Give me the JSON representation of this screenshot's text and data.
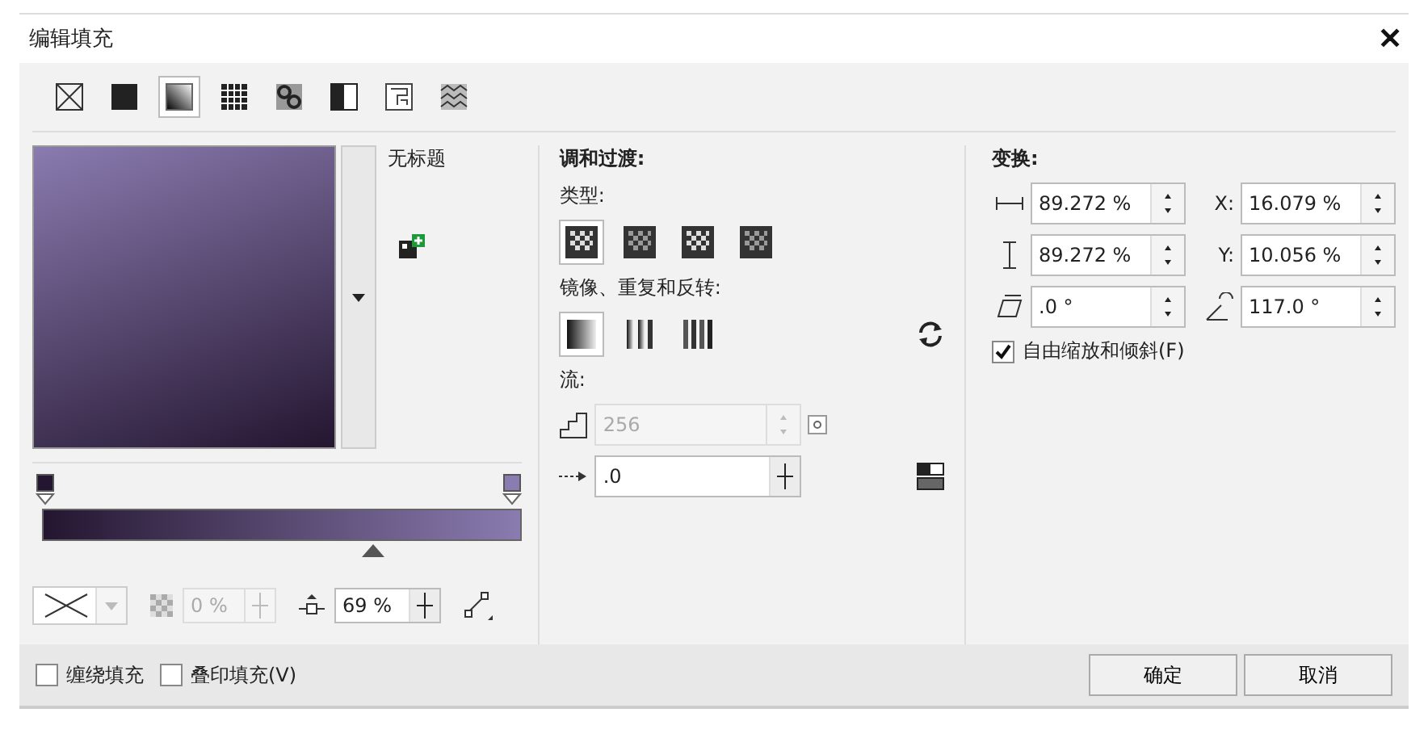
{
  "window": {
    "title": "编辑填充",
    "close": "✕"
  },
  "fill_types": [
    {
      "kind": "none",
      "selected": false
    },
    {
      "kind": "uniform",
      "selected": false
    },
    {
      "kind": "fountain",
      "selected": true
    },
    {
      "kind": "vector",
      "selected": false
    },
    {
      "kind": "bitmap",
      "selected": false
    },
    {
      "kind": "twocolor",
      "selected": false
    },
    {
      "kind": "texture",
      "selected": false
    },
    {
      "kind": "postscript",
      "selected": false
    }
  ],
  "preview": {
    "name": "无标题"
  },
  "nodes": [
    {
      "color": "#241630"
    },
    {
      "color": "#8a7bb0"
    }
  ],
  "midpoint": {
    "level": 0.69,
    "value": "69 %"
  },
  "transparency": {
    "value": "0 %",
    "disabled": true
  },
  "blend": {
    "title": "调和过渡:",
    "type_label": "类型:",
    "types": [
      {
        "selected": true
      },
      {
        "selected": false
      },
      {
        "selected": false
      },
      {
        "selected": false
      }
    ],
    "mirror_label": "镜像、重复和反转:",
    "mirror": [
      {
        "kind": "default",
        "selected": true
      },
      {
        "kind": "mirror",
        "selected": false
      },
      {
        "kind": "repeat",
        "selected": false
      }
    ],
    "flow_label": "流:",
    "steps": {
      "value": "256",
      "disabled": true
    },
    "acceleration": {
      "value": ".0"
    }
  },
  "transform": {
    "title": "变换:",
    "fields": [
      {
        "kind": "width",
        "value": "89.272 %"
      },
      {
        "kind": "x",
        "label": "X:",
        "value": "16.079 %"
      },
      {
        "kind": "height",
        "value": "89.272 %"
      },
      {
        "kind": "y",
        "label": "Y:",
        "value": "10.056 %"
      },
      {
        "kind": "skew",
        "value": ".0 °"
      },
      {
        "kind": "rotate",
        "value": "117.0 °"
      }
    ],
    "free_scale": {
      "label": "自由缩放和倾斜(F)",
      "checked": true
    }
  },
  "footer": {
    "options": [
      {
        "label": "缠绕填充",
        "checked": false
      },
      {
        "label": "叠印填充(V)",
        "checked": false
      }
    ],
    "buttons": [
      "确定",
      "取消"
    ]
  }
}
